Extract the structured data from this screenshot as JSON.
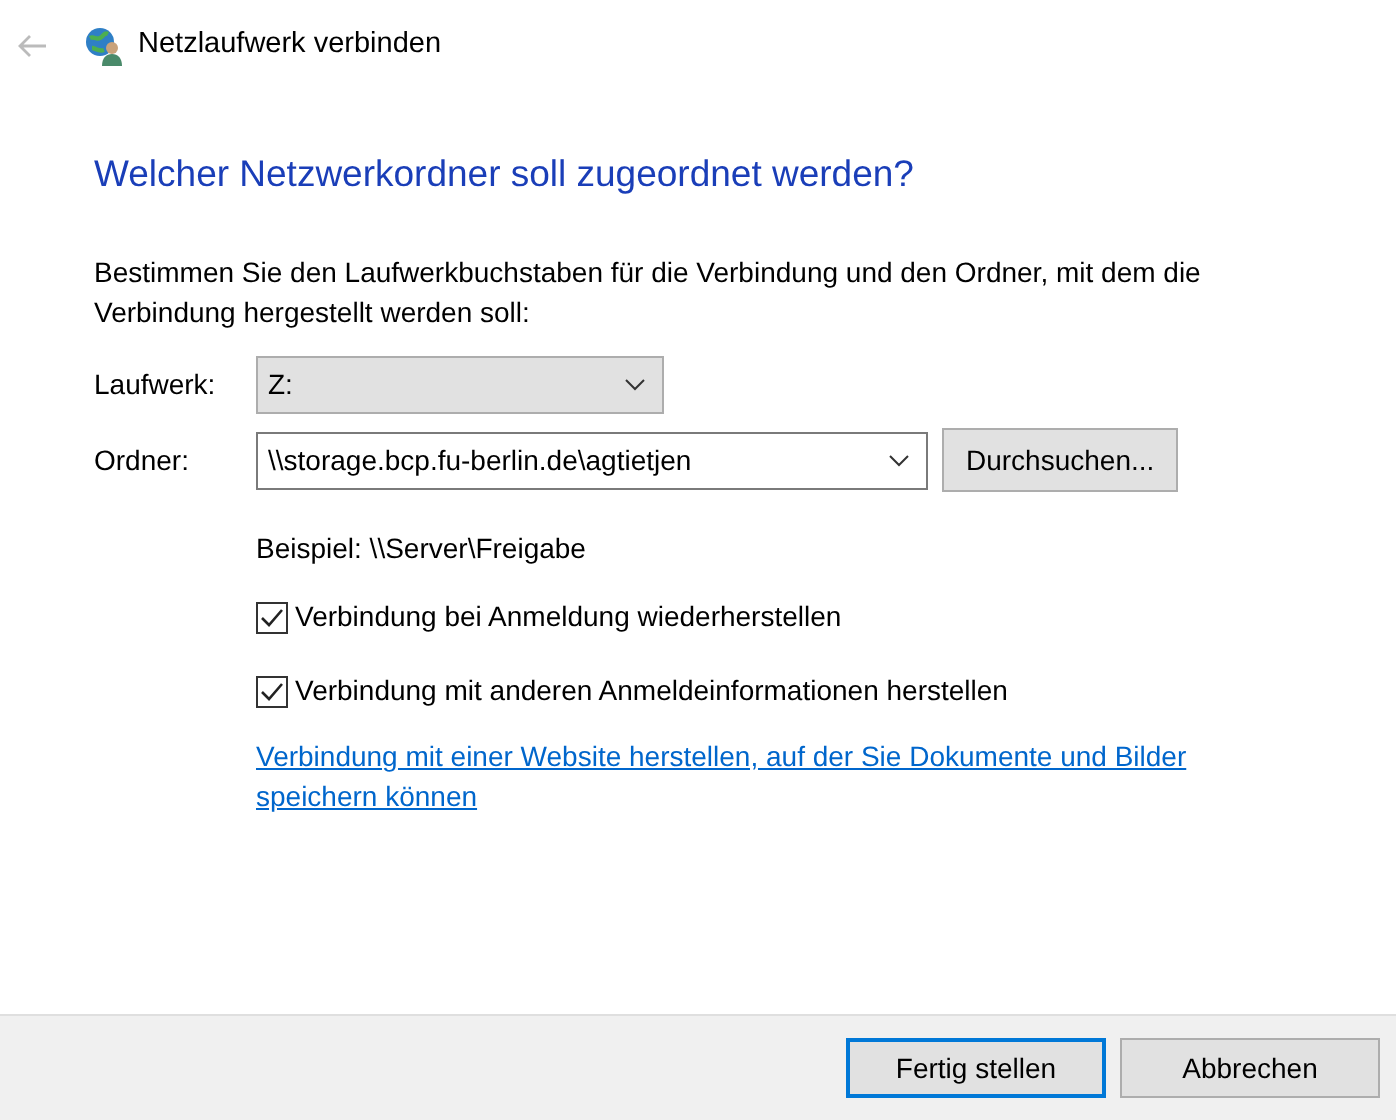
{
  "window": {
    "title": "Netzlaufwerk verbinden"
  },
  "heading": "Welcher Netzwerkordner soll zugeordnet werden?",
  "description": "Bestimmen Sie den Laufwerkbuchstaben für die Verbindung und den Ordner, mit dem die Verbindung hergestellt werden soll:",
  "drive": {
    "label": "Laufwerk:",
    "value": "Z:"
  },
  "folder": {
    "label": "Ordner:",
    "value": "\\\\storage.bcp.fu-berlin.de\\agtietjen",
    "browse_button": "Durchsuchen..."
  },
  "example": "Beispiel: \\\\Server\\Freigabe",
  "options": [
    {
      "label": "Verbindung bei Anmeldung wiederherstellen",
      "checked": true
    },
    {
      "label": "Verbindung mit anderen Anmeldeinformationen herstellen",
      "checked": true
    }
  ],
  "link": "Verbindung mit einer Website herstellen, auf der Sie Dokumente und Bilder speichern können",
  "buttons": [
    {
      "label": "Fertig stellen",
      "default": true
    },
    {
      "label": "Abbrechen",
      "default": false
    }
  ]
}
